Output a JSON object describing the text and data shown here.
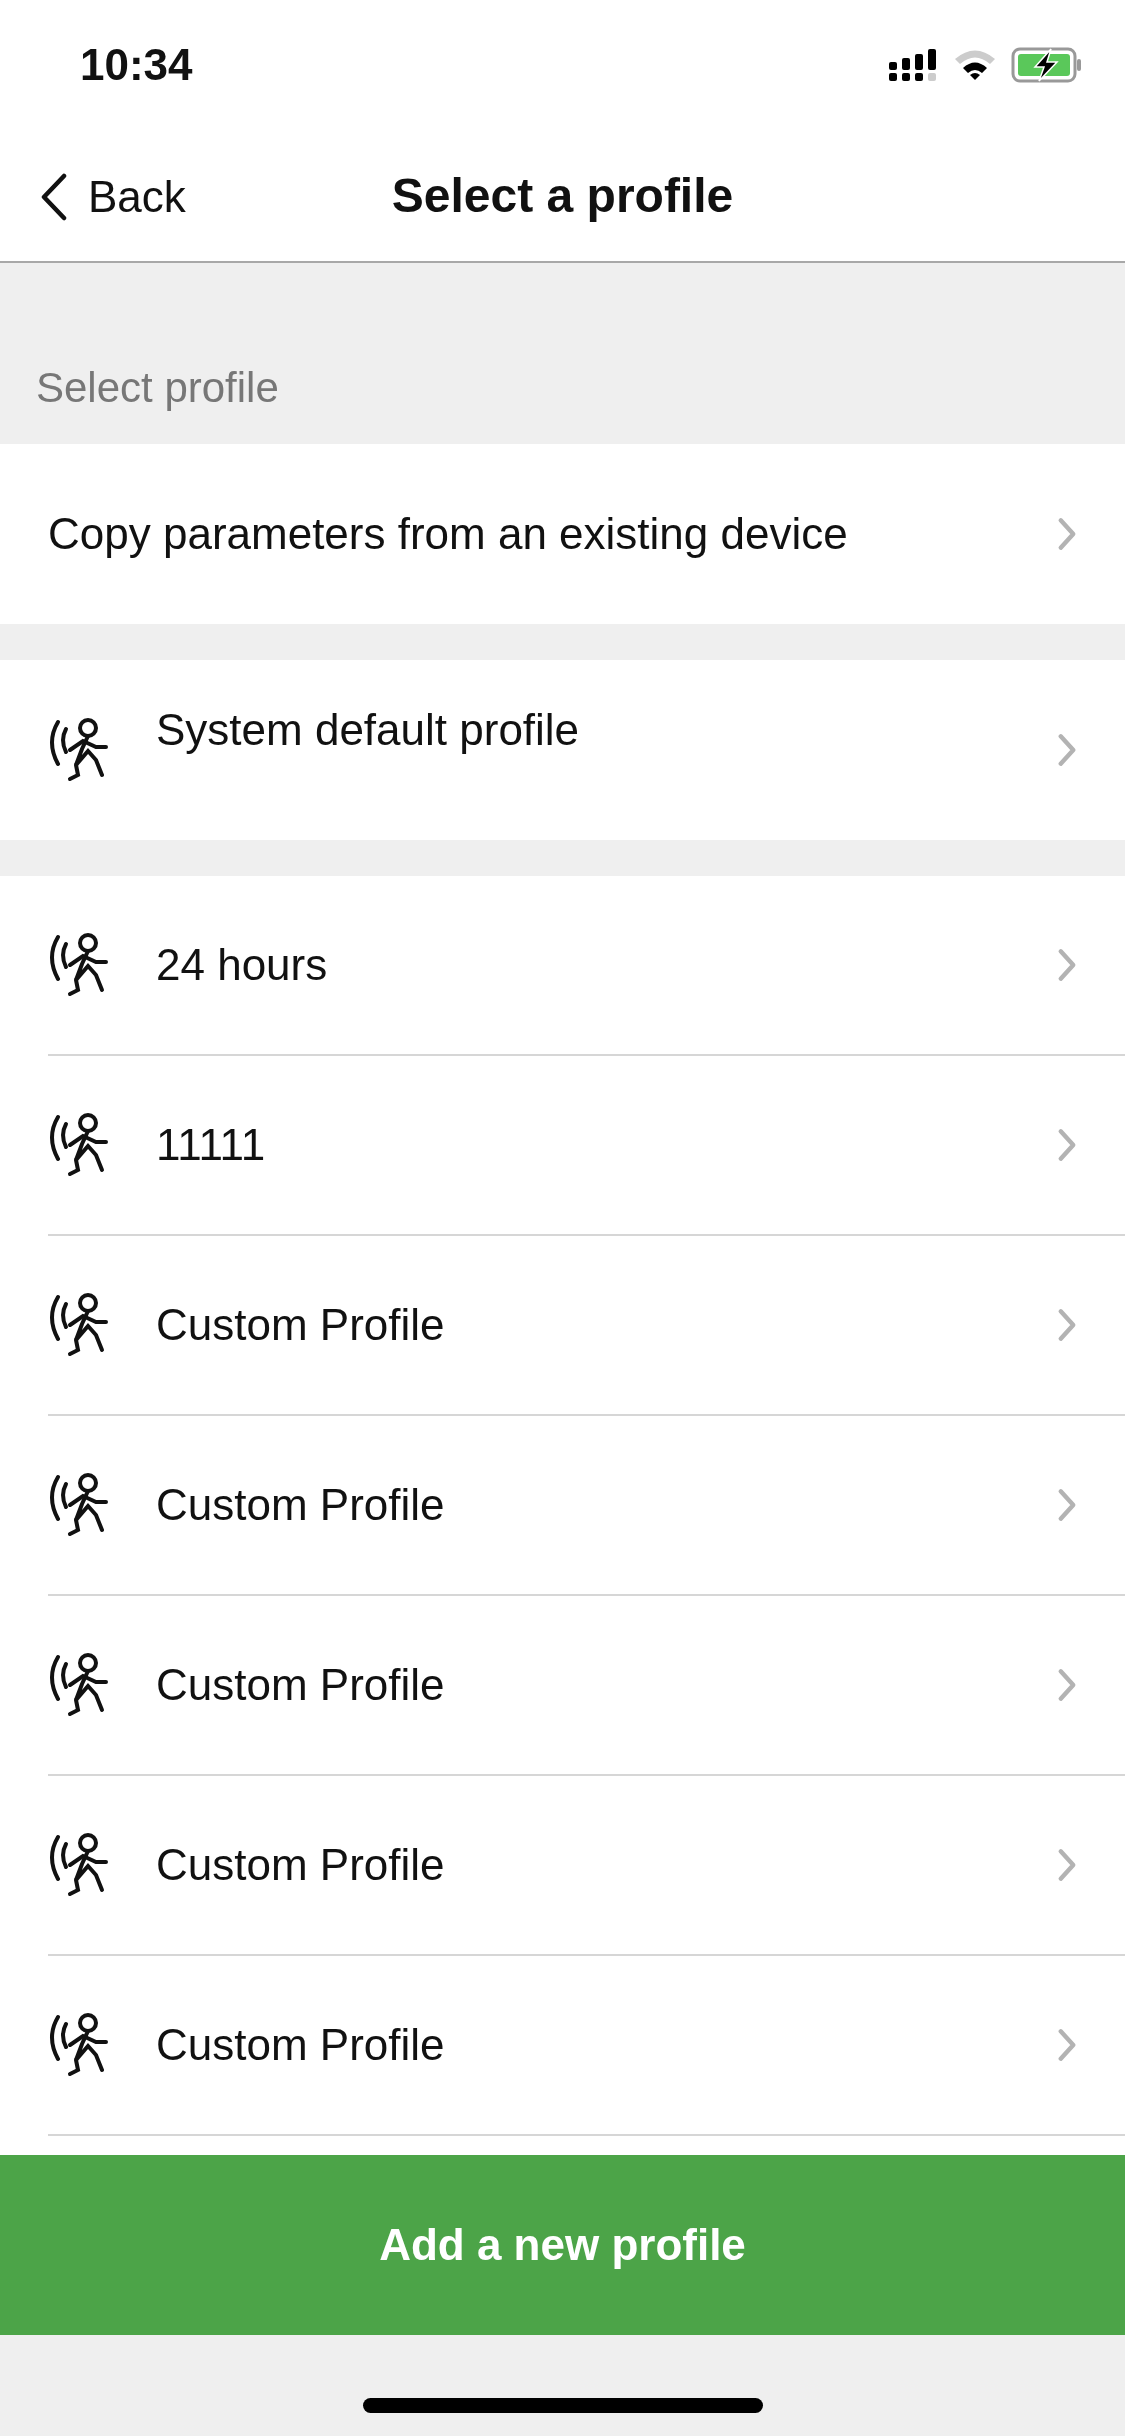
{
  "status_bar": {
    "time": "10:34"
  },
  "nav": {
    "back": "Back",
    "title": "Select a profile"
  },
  "section_header": "Select profile",
  "copy_row": {
    "label": "Copy parameters from an existing device"
  },
  "default_profile": {
    "label": "System default profile"
  },
  "profiles": [
    {
      "label": "24 hours"
    },
    {
      "label": "11111"
    },
    {
      "label": "Custom Profile"
    },
    {
      "label": "Custom Profile"
    },
    {
      "label": "Custom Profile"
    },
    {
      "label": "Custom Profile"
    },
    {
      "label": "Custom Profile"
    }
  ],
  "add_button": "Add a new profile"
}
